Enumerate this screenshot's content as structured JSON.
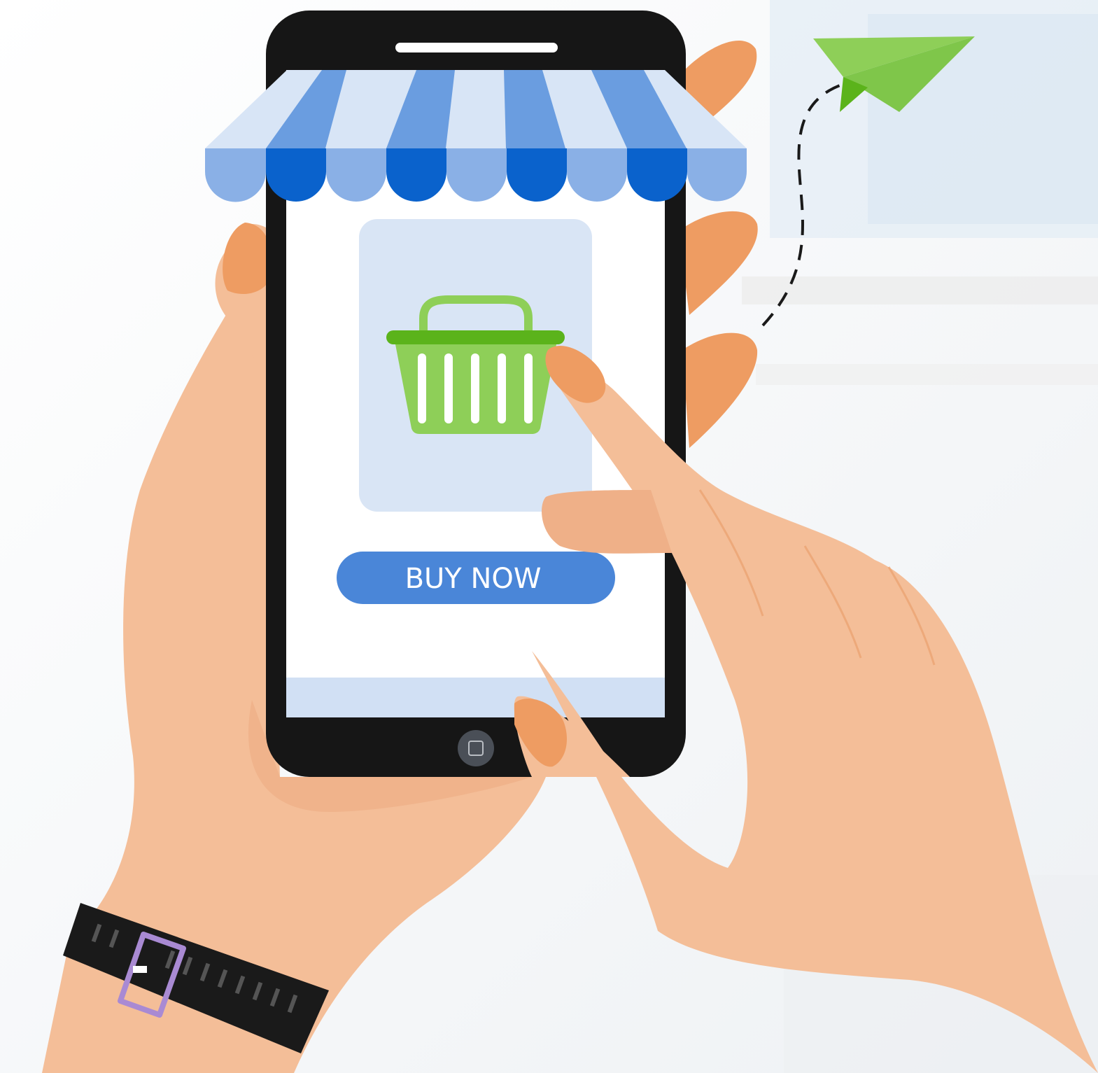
{
  "screen": {
    "buy_button_label": "BUY NOW"
  },
  "colors": {
    "awning_light": "#d8e5f6",
    "awning_mid": "#8ab0e6",
    "awning_dark": "#0a62cc",
    "button": "#4a86d8",
    "button_text": "#ffffff",
    "product_card": "#d9e5f5",
    "basket": "#8ecf58",
    "basket_rim": "#5bb31b",
    "paper_plane": "#7fc64a",
    "skin": "#f4be98",
    "skin_shadow": "#efb088",
    "fingernail": "#ee9c62",
    "phone_body": "#161616",
    "watch_strap": "#1a1a1a",
    "watch_buckle": "#a98ad3"
  },
  "icons": {
    "product": "shopping-basket-icon",
    "flying": "paper-plane-icon",
    "home": "home-button-icon"
  }
}
